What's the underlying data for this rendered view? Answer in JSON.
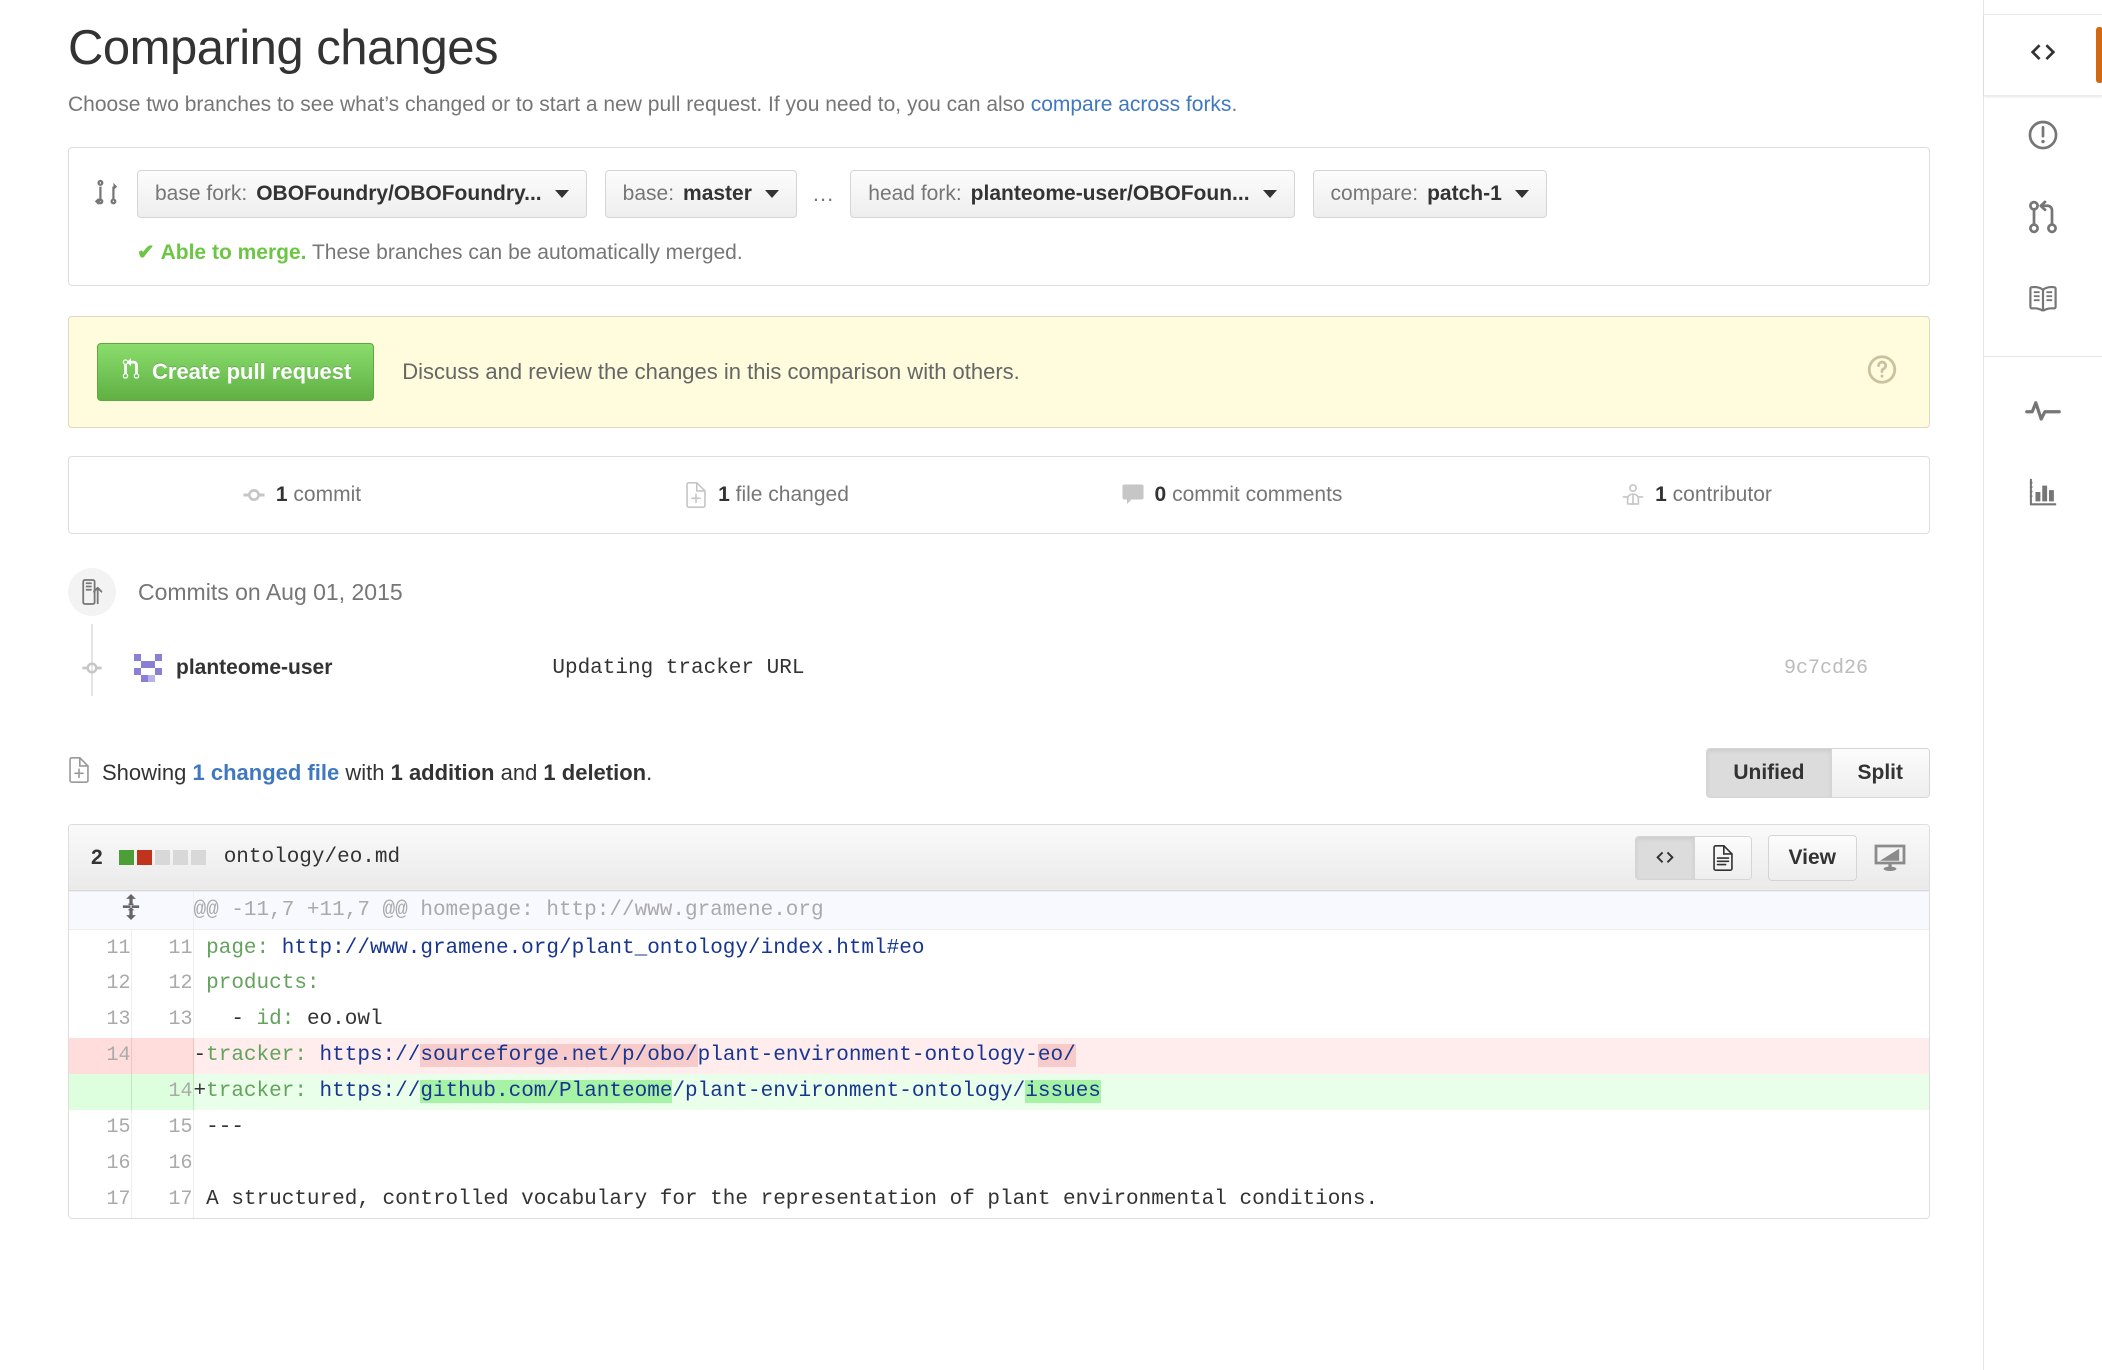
{
  "header": {
    "title": "Comparing changes",
    "subtitle_prefix": "Choose two branches to see what’s changed or to start a new pull request. If you need to, you can also ",
    "subtitle_link": "compare across forks",
    "subtitle_suffix": "."
  },
  "compare": {
    "base_fork_label": "base fork:",
    "base_fork_value": "OBOFoundry/OBOFoundry...",
    "base_label": "base:",
    "base_value": "master",
    "ellipsis": "...",
    "head_fork_label": "head fork:",
    "head_fork_value": "planteome-user/OBOFoun...",
    "compare_label": "compare:",
    "compare_value": "patch-1",
    "merge_status_bold": "Able to merge.",
    "merge_status_rest": "These branches can be automatically merged.",
    "check_glyph": "✔"
  },
  "pr_banner": {
    "button_label": "Create pull request",
    "description": "Discuss and review the changes in this comparison with others.",
    "help_icon": "question-circle-icon",
    "background": "#fffbdd"
  },
  "stats": [
    {
      "icon": "commit-icon",
      "count": "1",
      "label": "commit"
    },
    {
      "icon": "file-diff-icon",
      "count": "1",
      "label": "file changed"
    },
    {
      "icon": "comment-icon",
      "count": "0",
      "label": "commit comments"
    },
    {
      "icon": "organization-icon",
      "count": "1",
      "label": "contributor"
    }
  ],
  "commits": {
    "group_title": "Commits on Aug 01, 2015",
    "rows": [
      {
        "author": "planteome-user",
        "message": "Updating tracker URL",
        "sha": "9c7cd26"
      }
    ]
  },
  "showing": {
    "prefix": "Showing ",
    "link": "1 changed file",
    "mid": " with ",
    "additions": "1 addition",
    "and": " and ",
    "deletions": "1 deletion",
    "suffix": ".",
    "view_modes": [
      {
        "label": "Unified",
        "active": true
      },
      {
        "label": "Split",
        "active": false
      }
    ]
  },
  "file": {
    "change_count": "2",
    "diffstat_blocks": [
      "add",
      "del",
      "none",
      "none",
      "none"
    ],
    "name": "ontology/eo.md",
    "toggle": [
      {
        "icon": "code-icon",
        "active": true
      },
      {
        "icon": "file-icon",
        "active": false
      }
    ],
    "view_button": "View",
    "fullscreen_icon": "desktop-download-icon",
    "hunk_header": "@@ -11,7 +11,7 @@ homepage: http://www.gramene.org",
    "expand_icon": "unfold-icon",
    "lines": [
      {
        "type": "ctx",
        "old": "11",
        "new": "11",
        "prefix": " ",
        "parts": [
          {
            "t": "page:",
            "c": "k"
          },
          {
            "t": " ",
            "c": ""
          },
          {
            "t": "http://www.gramene.org/plant_ontology/index.html#eo",
            "c": "u"
          }
        ]
      },
      {
        "type": "ctx",
        "old": "12",
        "new": "12",
        "prefix": " ",
        "parts": [
          {
            "t": "products:",
            "c": "k"
          }
        ]
      },
      {
        "type": "ctx",
        "old": "13",
        "new": "13",
        "prefix": " ",
        "parts": [
          {
            "t": "  - ",
            "c": ""
          },
          {
            "t": "id:",
            "c": "k"
          },
          {
            "t": " eo.owl",
            "c": ""
          }
        ]
      },
      {
        "type": "del",
        "old": "14",
        "new": "",
        "prefix": "-",
        "parts": [
          {
            "t": "tracker:",
            "c": "k"
          },
          {
            "t": " ",
            "c": ""
          },
          {
            "t": "https://",
            "c": "u"
          },
          {
            "t": "sourceforge.net/p/obo/",
            "c": "u hl-del"
          },
          {
            "t": "plant-environment-ontology-",
            "c": "u"
          },
          {
            "t": "eo/",
            "c": "u hl-del"
          }
        ]
      },
      {
        "type": "add",
        "old": "",
        "new": "14",
        "prefix": "+",
        "parts": [
          {
            "t": "tracker:",
            "c": "k"
          },
          {
            "t": " ",
            "c": ""
          },
          {
            "t": "https://",
            "c": "u"
          },
          {
            "t": "github.com/Planteome",
            "c": "u hl-add"
          },
          {
            "t": "/plant-environment-ontology/",
            "c": "u"
          },
          {
            "t": "issues",
            "c": "u hl-add"
          }
        ]
      },
      {
        "type": "ctx",
        "old": "15",
        "new": "15",
        "prefix": " ",
        "parts": [
          {
            "t": "---",
            "c": ""
          }
        ]
      },
      {
        "type": "ctx",
        "old": "16",
        "new": "16",
        "prefix": " ",
        "parts": [
          {
            "t": "",
            "c": ""
          }
        ]
      },
      {
        "type": "ctx",
        "old": "17",
        "new": "17",
        "prefix": " ",
        "parts": [
          {
            "t": "A structured, controlled vocabulary for the representation of plant environmental conditions.",
            "c": ""
          }
        ]
      }
    ]
  },
  "rail_right": {
    "items": [
      {
        "icon": "code-icon",
        "active": true
      },
      {
        "icon": "issue-opened-icon",
        "active": false
      },
      {
        "icon": "git-pull-request-icon",
        "active": false
      },
      {
        "icon": "book-icon",
        "active": false
      },
      {
        "divider": true
      },
      {
        "icon": "pulse-icon",
        "active": false
      },
      {
        "icon": "graph-icon",
        "active": false
      }
    ]
  },
  "colors": {
    "accent_orange": "#d26911",
    "link_blue": "#4078c0",
    "green": "#6cc644",
    "add_bg": "#eaffea",
    "del_bg": "#ffecec"
  }
}
